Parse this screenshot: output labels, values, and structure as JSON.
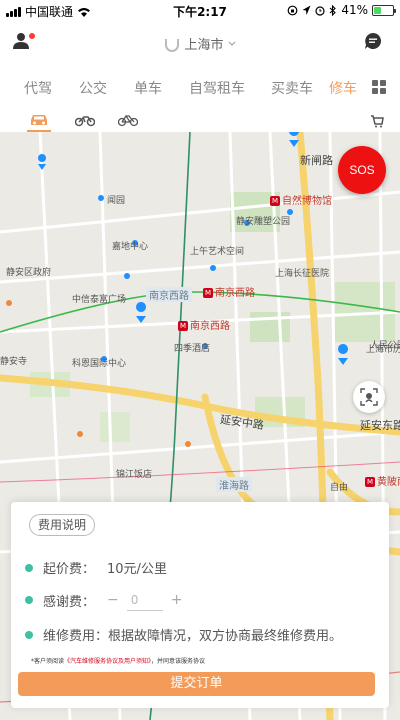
{
  "status_bar": {
    "carrier": "中国联通",
    "time": "下午2:17",
    "battery_text": "41%",
    "battery_level": 0.41
  },
  "header": {
    "city": "上海市"
  },
  "tabs": [
    {
      "label": "代驾",
      "active": false
    },
    {
      "label": "公交",
      "active": false
    },
    {
      "label": "单车",
      "active": false
    },
    {
      "label": "自驾租车",
      "active": false
    },
    {
      "label": "买卖车",
      "active": false
    },
    {
      "label": "修车",
      "active": true
    }
  ],
  "sub_tabs": [
    "car-icon",
    "motorcycle-icon",
    "bicycle-icon"
  ],
  "map": {
    "labels": {
      "xinzha": "新闸路",
      "museum": "自然博物馆",
      "jingan_sculpture": "静安雕塑公园",
      "wenyuan": "闻园",
      "plaza": "嘉地中心",
      "jingan_gov": "静安区政府",
      "art_space": "上午艺术空间",
      "long_hospital": "上海长征医院",
      "zhongxin": "中信泰富广场",
      "nanjing_w_road": "南京西路",
      "nanjing_w_station1": "南京西路",
      "nanjing_w_station2": "南京西路",
      "people_park": "人民公园",
      "sijin": "四季酒店",
      "art_museum": "上海市历史",
      "jingan_temple": "静安寺",
      "kerry": "科恩国际中心",
      "yanan_mid": "延安中路",
      "yanan_e": "延安东路",
      "jinjiang": "锦江饭店",
      "huaihai": "淮海路",
      "huangpi": "黄陂南路",
      "zili": "自由"
    }
  },
  "sos_label": "SOS",
  "card": {
    "fee_explain": "费用说明",
    "start_fee_label": "起价费：",
    "start_fee_value": "10元/公里",
    "tip_label": "感谢费：",
    "tip_minus": "−",
    "tip_value": "0",
    "tip_plus": "+",
    "repair_fee": "维修费用：根据故障情况，双方协商最终维修费用。",
    "notice_pre": "*客户须阅读",
    "notice_link": "《汽车维修服务协议及用户须知》",
    "notice_post": "，并同意该服务协议",
    "submit_label": "提交订单"
  },
  "colors": {
    "accent": "#f39c5a",
    "sos": "#ee1111",
    "bullet": "#3fc1a0",
    "metro": "#d0021b"
  }
}
